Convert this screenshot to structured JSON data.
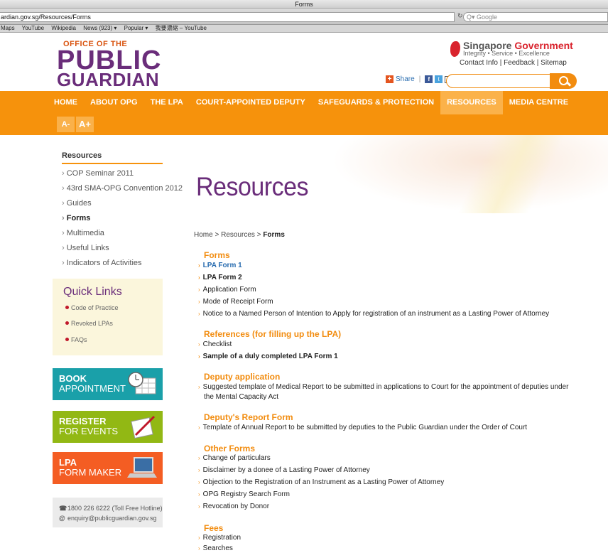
{
  "browser": {
    "title": "Forms",
    "url": "ardian.gov.sg/Resources/Forms",
    "search_placeholder": "Google",
    "bookmarks": [
      "Maps",
      "YouTube",
      "Wikipedia",
      "News (923) ▾",
      "Popular ▾",
      "我要濃縮 – YouTube"
    ]
  },
  "header": {
    "logo": {
      "line1": "OFFICE OF THE",
      "line2": "PUBLIC",
      "line3": "GUARDIAN"
    },
    "gov": {
      "name1": "Singapore",
      "name2": "Government",
      "tagline": "Integrity • Service • Excellence"
    },
    "toplinks": {
      "contact": "Contact Info",
      "feedback": "Feedback",
      "sitemap": "Sitemap"
    },
    "share_label": "Share"
  },
  "nav": {
    "items": [
      "HOME",
      "ABOUT OPG",
      "THE LPA",
      "COURT-APPOINTED DEPUTY",
      "SAFEGUARDS & PROTECTION",
      "RESOURCES",
      "MEDIA CENTRE"
    ],
    "font_small": "A-",
    "font_large": "A+"
  },
  "sidebar": {
    "title": "Resources",
    "items": [
      "COP Seminar 2011",
      "43rd SMA-OPG Convention 2012",
      "Guides",
      "Forms",
      "Multimedia",
      "Useful Links",
      "Indicators of Activities"
    ],
    "quicklinks": {
      "title": "Quick Links",
      "items": [
        "Code of Practice",
        "Revoked LPAs",
        "FAQs"
      ]
    },
    "banners": {
      "book": {
        "l1": "BOOK",
        "l2": "APPOINTMENT"
      },
      "register": {
        "l1": "REGISTER",
        "l2": "FOR EVENTS"
      },
      "lpa": {
        "l1": "LPA",
        "l2": "FORM MAKER"
      }
    },
    "contact": {
      "phone": "1800 226 6222 (Toll Free Hotline)",
      "email": "enquiry@publicguardian.gov.sg"
    }
  },
  "main": {
    "title": "Resources",
    "breadcrumb": {
      "home": "Home",
      "resources": "Resources",
      "current": "Forms"
    },
    "sections": {
      "forms": {
        "heading": "Forms",
        "items": [
          "LPA Form 1",
          "LPA Form 2",
          "Application Form",
          "Mode of Receipt Form",
          "Notice to a Named Person of Intention to Apply for registration of an instrument as a Lasting Power of Attorney"
        ]
      },
      "references": {
        "heading": "References (for filling up the LPA)",
        "items": [
          "Checklist",
          "Sample of a duly completed LPA Form 1"
        ]
      },
      "deputy": {
        "heading": "Deputy application",
        "line1": "Suggested template of Medical Report to be submitted in applications to Court for the appointment of deputies under",
        "line2": "the Mental Capacity Act"
      },
      "report": {
        "heading": "Deputy's Report Form",
        "item": "Template of Annual Report to be submitted by deputies to the Public Guardian under the Order of Court"
      },
      "other": {
        "heading": "Other Forms",
        "items": [
          "Change of particulars",
          "Disclaimer by a donee of a Lasting Power of Attorney",
          "Objection to the Registration of an Instrument as a Lasting Power of Attorney",
          "OPG Registry Search Form",
          "Revocation by Donor"
        ]
      },
      "fees": {
        "heading": "Fees",
        "items": [
          "Registration",
          "Searches"
        ]
      }
    }
  }
}
